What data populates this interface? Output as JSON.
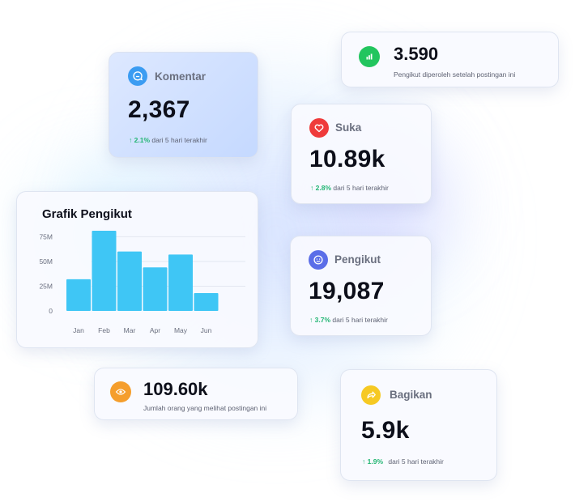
{
  "cards": {
    "comments": {
      "label": "Komentar",
      "value": "2,367",
      "trend_pct": "2.1%",
      "trend_text": "dari 5 hari terakhir",
      "icon": "comment-icon",
      "icon_color": "#3b9cf2"
    },
    "followers_gain": {
      "value": "3.590",
      "description": "Pengikut diperoleh setelah postingan ini",
      "icon": "bar-chart-icon",
      "icon_color": "#22c55e"
    },
    "likes": {
      "label": "Suka",
      "value": "10.89k",
      "trend_pct": "2.8%",
      "trend_text": "dari 5 hari terakhir",
      "icon": "heart-icon",
      "icon_color": "#ef3b3b"
    },
    "followers": {
      "label": "Pengikut",
      "value": "19,087",
      "trend_pct": "3.7%",
      "trend_text": "dari 5 hari terakhir",
      "icon": "smile-icon",
      "icon_color": "#5b6ee8"
    },
    "views": {
      "value": "109.60k",
      "description": "Jumlah orang yang melihat postingan ini",
      "icon": "eye-icon",
      "icon_color": "#f59e2c"
    },
    "shares": {
      "label": "Bagikan",
      "value": "5.9k",
      "trend_pct": "1.9%",
      "trend_text": "dari 5 hari terakhir",
      "icon": "share-icon",
      "icon_color": "#f6c923"
    }
  },
  "trend_arrow": "↑",
  "accent_green": "#22b573",
  "chart_data": {
    "type": "bar",
    "title": "Grafik Pengikut",
    "categories": [
      "Jan",
      "Feb",
      "Mar",
      "Apr",
      "May",
      "Jun"
    ],
    "values": [
      32,
      81,
      60,
      44,
      57,
      18
    ],
    "yticks": [
      "0",
      "25M",
      "50M",
      "75M"
    ],
    "ytick_values": [
      0,
      25,
      50,
      75
    ],
    "ylim": [
      0,
      81
    ],
    "grid": true,
    "bar_color": "#3fc6f5"
  }
}
